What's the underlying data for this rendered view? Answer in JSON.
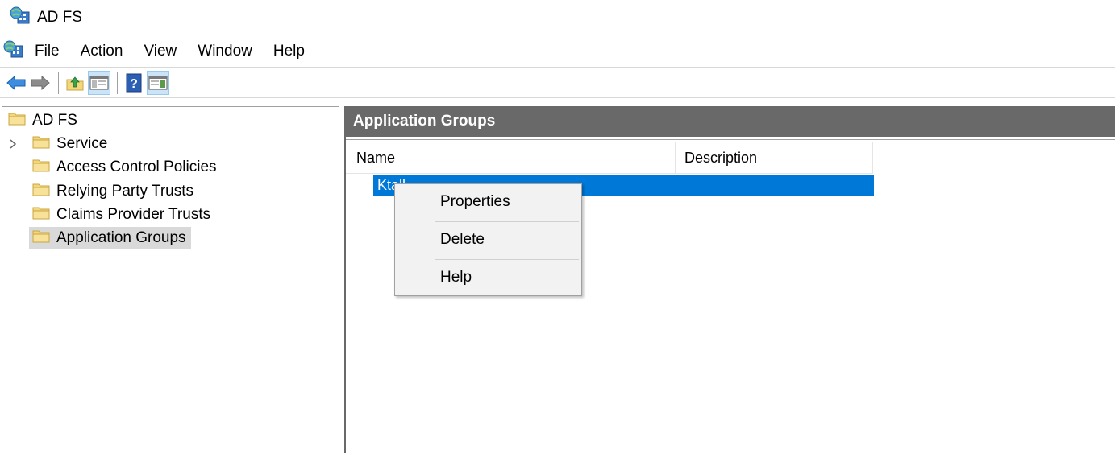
{
  "window": {
    "title": "AD FS",
    "app_icon": "adfs-icon"
  },
  "menubar": {
    "items": [
      "File",
      "Action",
      "View",
      "Window",
      "Help"
    ]
  },
  "toolbar": {
    "buttons": [
      "back-arrow-icon",
      "forward-arrow-icon",
      "up-folder-icon",
      "show-hide-console-tree-icon",
      "help-icon",
      "show-hide-action-pane-icon"
    ]
  },
  "tree": {
    "root": "AD FS",
    "items": [
      {
        "label": "Service",
        "expandable": true
      },
      {
        "label": "Access Control Policies"
      },
      {
        "label": "Relying Party Trusts"
      },
      {
        "label": "Claims Provider Trusts"
      },
      {
        "label": "Application Groups",
        "selected": true
      }
    ]
  },
  "main": {
    "header": "Application Groups",
    "columns": [
      "Name",
      "Description"
    ],
    "rows": [
      {
        "name": "Ktall",
        "description": ""
      }
    ]
  },
  "context_menu": {
    "items": [
      "Properties",
      "Delete",
      "Help"
    ]
  },
  "colors": {
    "selection": "#0078d7",
    "pane_header": "#696969",
    "tree_selected": "#d9d9d9",
    "folder": "#f5d67a"
  }
}
